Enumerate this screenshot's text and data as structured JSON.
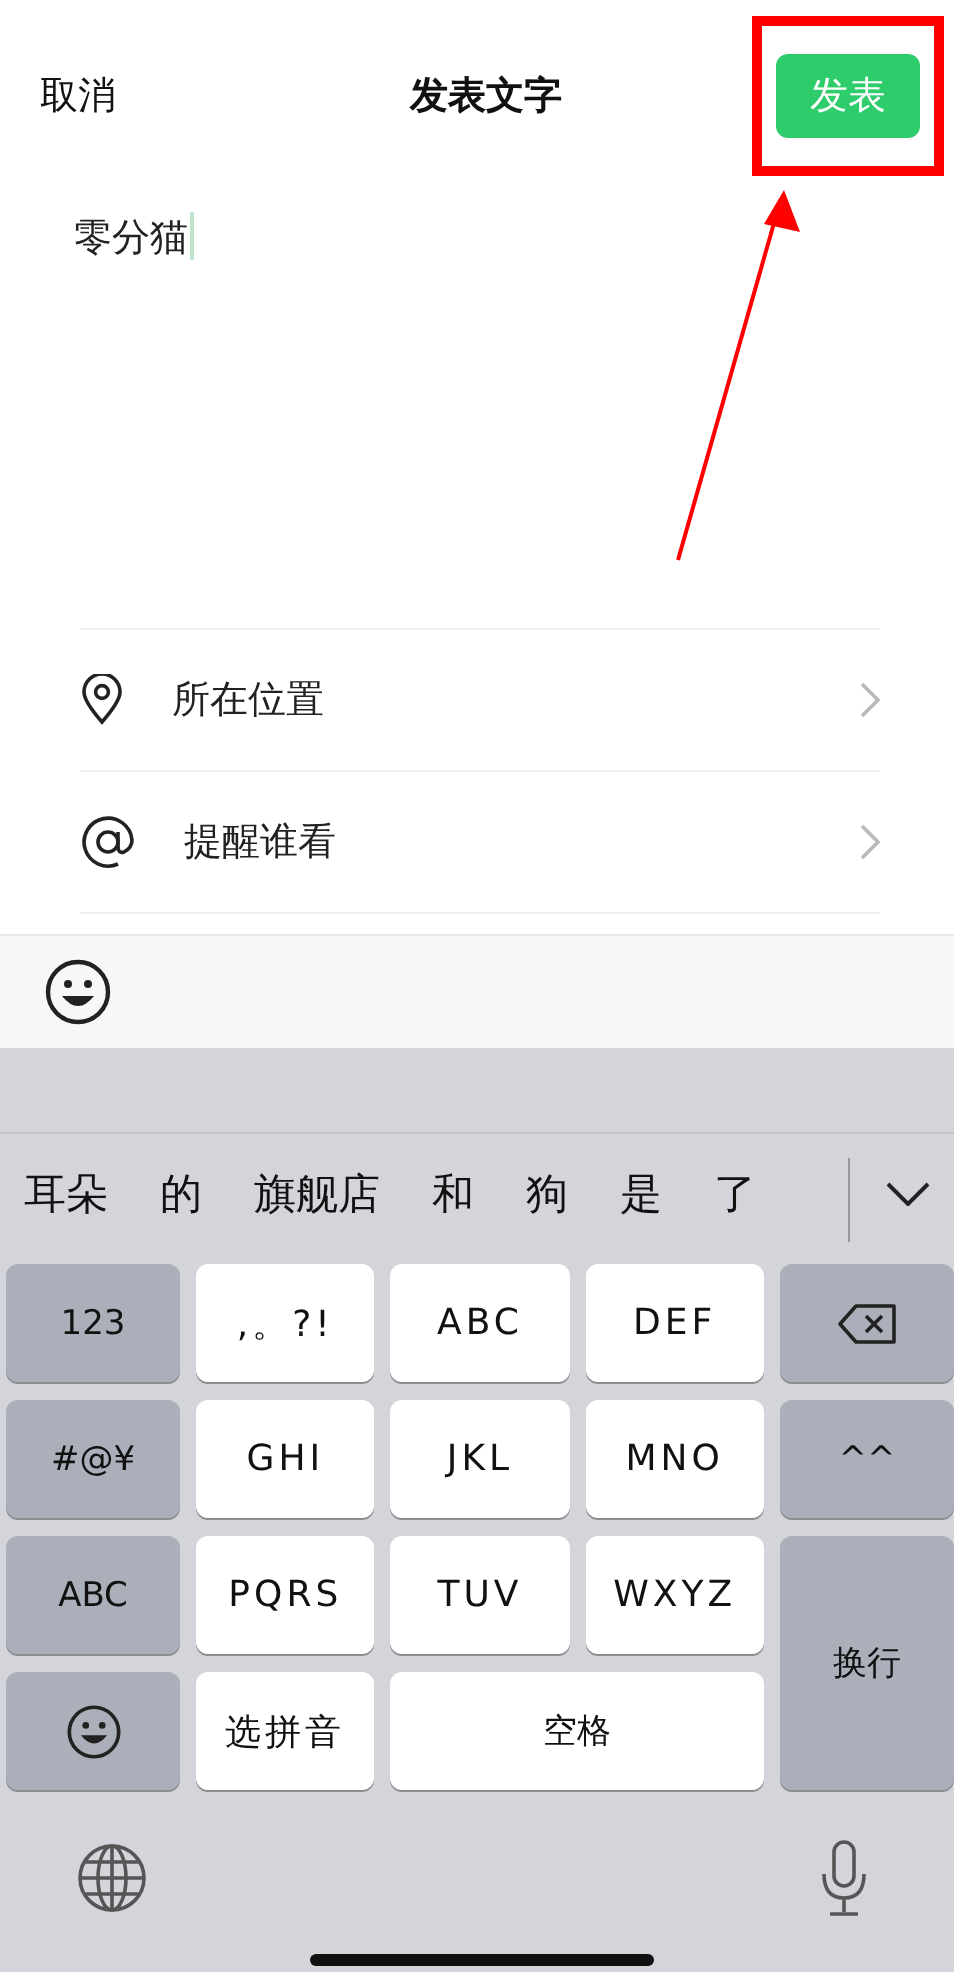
{
  "header": {
    "cancel": "取消",
    "title": "发表文字",
    "publish": "发表"
  },
  "post_text": "零分猫",
  "options": [
    {
      "kind": "location",
      "label": "所在位置"
    },
    {
      "kind": "mention",
      "label": "提醒谁看"
    }
  ],
  "candidates": [
    "耳朵",
    "的",
    "旗舰店",
    "和",
    "狗",
    "是",
    "了"
  ],
  "keys": [
    {
      "kind": "function",
      "label": "123"
    },
    {
      "kind": "letter",
      "label": ",。?!"
    },
    {
      "kind": "letter",
      "label": "ABC"
    },
    {
      "kind": "letter",
      "label": "DEF"
    },
    {
      "kind": "delete"
    },
    {
      "kind": "function",
      "label": "#@¥"
    },
    {
      "kind": "letter",
      "label": "GHI"
    },
    {
      "kind": "letter",
      "label": "JKL"
    },
    {
      "kind": "letter",
      "label": "MNO"
    },
    {
      "kind": "function",
      "label": "^^"
    },
    {
      "kind": "function",
      "label": "ABC"
    },
    {
      "kind": "letter",
      "label": "PQRS"
    },
    {
      "kind": "letter",
      "label": "TUV"
    },
    {
      "kind": "letter",
      "label": "WXYZ"
    },
    {
      "kind": "return",
      "label": "换行"
    },
    {
      "kind": "emoji"
    },
    {
      "kind": "letter",
      "label": "选拼音"
    },
    {
      "kind": "space",
      "label": "空格"
    }
  ]
}
